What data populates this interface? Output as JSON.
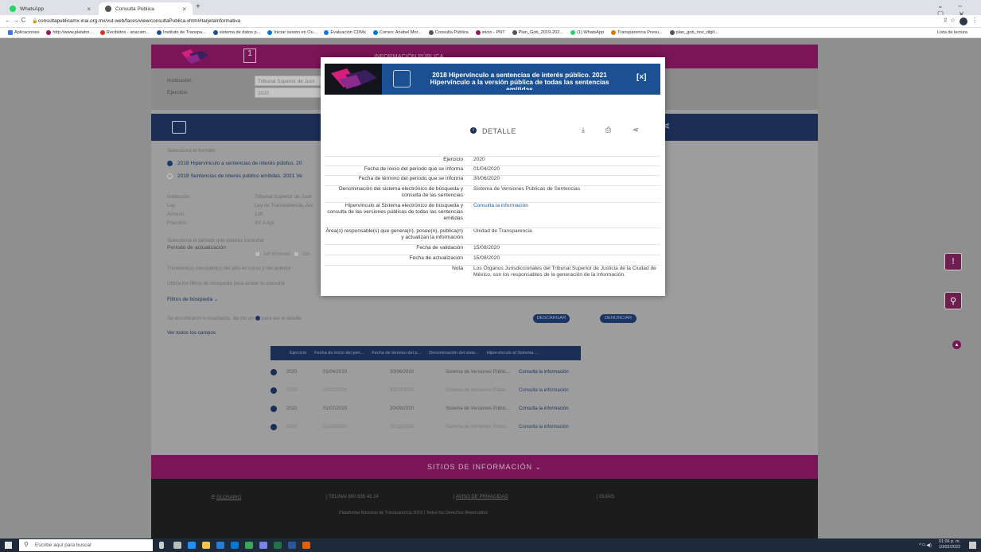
{
  "browser": {
    "tabs": [
      {
        "label": "WhatsApp",
        "color": "#25d366"
      },
      {
        "label": "Consulta Pública",
        "color": "#555555"
      }
    ],
    "url": "consultapublicamx.inai.org.mx/vut-web/faces/view/consultaPublica.xhtml#tarjetaInformativa",
    "bookmarks": [
      "Aplicaciones",
      "http://www.platafor...",
      "Recibidos - anacam...",
      "Instituto de Transpa...",
      "sistema de datos p...",
      "Iniciar sesión en Ou...",
      "Evaluación CDMx",
      "Correo: Anabel Mor...",
      "Consulta Pública",
      "inicio - PNT",
      "Plan_Gob_2019-202...",
      "(1) WhatsApp",
      "Transparencia Presu...",
      "plan_gob_nov_digit..."
    ],
    "reading_list": "Lista de lectura"
  },
  "header": {
    "title": "INFORMACIÓN PÚBLICA"
  },
  "filters": {
    "institucion_label": "Institución",
    "institucion_value": "Tribunal Superior de Justi",
    "ejercicio_label": "Ejercicio",
    "ejercicio_value": "2020"
  },
  "format": {
    "title": "Selecciona el formato",
    "option1": "2018 Hipervínculo a sentencias de interés público. 20",
    "option2": "2018 Sentencias de interés público emitidas. 2021 Ve"
  },
  "info": [
    {
      "label": "Institución",
      "value": "Tribunal Superior de Justi"
    },
    {
      "label": "Ley",
      "value": "Ley de Transparencia, Acc"
    },
    {
      "label": "Artículo",
      "value": "126"
    },
    {
      "label": "Fracción",
      "value": "XV A Api"
    }
  ],
  "period": {
    "title": "Selecciona el periodo que quieres consultar",
    "label": "Periodo de actualización",
    "opt1": "1er trimestre",
    "opt2": "2do",
    "note1": "Trimestre(s) concluido(s) del año en curso y del anterior",
    "note2": "Utiliza los filtros de búsqueda para acotar tu consulta",
    "filters_link": "Filtros de búsqueda"
  },
  "results": {
    "summary": "Se encontraron 4 resultados, da clic en",
    "summary2": "para ver el detalle.",
    "see_all": "Ver todos los campos",
    "download": "DESCARGAR",
    "report": "DENUNCIAR",
    "columns": [
      "Ejercicio",
      "Fecha de inicio del peri...",
      "Fecha de término del p...",
      "Denominación del siste...",
      "Hipervínculo al Sistema ..."
    ],
    "rows": [
      [
        "2020",
        "01/04/2020",
        "30/06/2020",
        "Sistema de Versiones Públic...",
        "Consulta la información"
      ],
      [
        "2020",
        "01/01/2020",
        "31/03/2020",
        "Sistema de Versiones Públic...",
        "Consulta la información"
      ],
      [
        "2020",
        "01/07/2020",
        "30/09/2020",
        "Sistema de Versiones Públic...",
        "Consulta la información"
      ],
      [
        "2020",
        "01/10/2020",
        "31/12/2020",
        "Sistema de Versiones Públic...",
        "Consulta la información"
      ]
    ]
  },
  "modal": {
    "title_line1": "2018 Hipervínculo a sentencias de interés público. 2021",
    "title_line2": "Hipervínculo a la versión pública de todas las sentencias",
    "title_line3": "emitidas",
    "close": "[×]",
    "detail": "DETALLE",
    "rows": [
      {
        "k": "Ejercicio",
        "v": "2020"
      },
      {
        "k": "Fecha de inicio del periodo que se informa",
        "v": "01/04/2020"
      },
      {
        "k": "Fecha de término del periodo que se informa",
        "v": "30/06/2020"
      },
      {
        "k": "Denominación del sistema electrónico de búsqueda y consulta de las sentencias",
        "v": "Sistema de Versiones Públicas de Sentencias"
      },
      {
        "k": "Hipervínculo al Sistema electrónico de búsqueda y consulta de las versiones públicas de todas las sentencias emitidas",
        "v": "Consulta la información"
      },
      {
        "k": "Área(s) responsable(s) que genera(n), posee(n), publica(n) y actualizan la información",
        "v": "Unidad de Transparencia"
      },
      {
        "k": "Fecha de validación",
        "v": "15/08/2020"
      },
      {
        "k": "Fecha de actualización",
        "v": "15/08/2020"
      },
      {
        "k": "Nota",
        "v": "Los Órganos Jurisdiccionales del Tribunal Superior de Justicia de la Ciudad de México, son los responsables de la generación de la información."
      }
    ]
  },
  "footer": {
    "sites": "SITIOS DE INFORMACIÓN",
    "glosario": "GLOSARIO",
    "telinai": "TELINAI 800 835 43 24",
    "aviso": "AVISO DE PRIVACIDAD",
    "guias": "GUÍAS",
    "copyright": "Plataforma Nacional de Transparencia 2019 | Todos los Derechos Reservados"
  },
  "taskbar": {
    "search": "Escribe aquí para buscar",
    "time": "01:06 p. m.",
    "date": "10/02/2022"
  },
  "colors": {
    "magenta": "#7a1657",
    "blue": "#1b5193",
    "link": "#1f5fa6"
  }
}
